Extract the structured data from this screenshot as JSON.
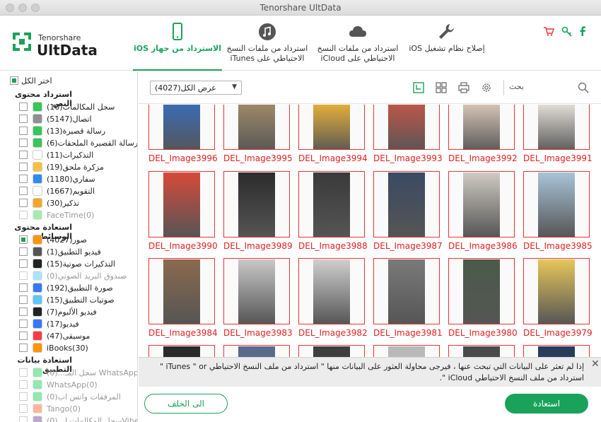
{
  "window": {
    "title": "Tenorshare UltData"
  },
  "logo": {
    "brand": "Tenorshare",
    "name": "UltData"
  },
  "nav": [
    {
      "label": "الاسترداد من جهاز iOS",
      "active": true
    },
    {
      "label": "استرداد من ملفات النسخ الاحتياطي على iTunes",
      "active": false
    },
    {
      "label": "استرداد  من  ملفات النسخ الاحتياطي على iCloud",
      "active": false
    },
    {
      "label": "إصلاح نظام تشغيل iOS",
      "active": false
    }
  ],
  "header_icons": [
    "cart-icon",
    "key-icon",
    "facebook-icon"
  ],
  "sidebar": {
    "select_all": "اختر الكل",
    "groups": [
      {
        "title": "استرداد محتوى النص",
        "items": [
          {
            "label": "سجل المكالمات(10)",
            "checked": false,
            "enabled": true,
            "color": "#35c759"
          },
          {
            "label": "اتصال(5147)",
            "checked": false,
            "enabled": true,
            "color": "#8e8e93"
          },
          {
            "label": "رسالة قصيرة(13)",
            "checked": false,
            "enabled": true,
            "color": "#34c759"
          },
          {
            "label": "رسالة القصيرة الملحقات(6)",
            "checked": false,
            "enabled": true,
            "color": "#34c759"
          },
          {
            "label": "التذكيرات(11)",
            "checked": false,
            "enabled": true,
            "color": "#ffffff"
          },
          {
            "label": "مزكرة ملحق(19)",
            "checked": false,
            "enabled": true,
            "color": "#f7c23a"
          },
          {
            "label": "سفاري(1180)",
            "checked": false,
            "enabled": true,
            "color": "#2d8cf0"
          },
          {
            "label": "التقويم(1667)",
            "checked": false,
            "enabled": true,
            "color": "#ffffff"
          },
          {
            "label": "تذكير(30)",
            "checked": false,
            "enabled": true,
            "color": "#f5a623"
          },
          {
            "label": "(0)FaceTime",
            "checked": false,
            "enabled": false,
            "color": "#4cd964"
          }
        ]
      },
      {
        "title": "استعادة محتوى الوسائط",
        "items": [
          {
            "label": "صور(4027)",
            "checked": true,
            "enabled": true,
            "color": "#ff9500"
          },
          {
            "label": "فيديو التطبيق(1)",
            "checked": false,
            "enabled": true,
            "color": "#555555"
          },
          {
            "label": "التذكيرات صوتية(15)",
            "checked": false,
            "enabled": true,
            "color": "#222222"
          },
          {
            "label": "صندوق البريد الصوتي(0)",
            "checked": false,
            "enabled": false,
            "color": "#5ac8fa"
          },
          {
            "label": "صورة التطبيق(192)",
            "checked": false,
            "enabled": true,
            "color": "#3478f6"
          },
          {
            "label": "صوتيات التطبيق(15)",
            "checked": false,
            "enabled": true,
            "color": "#5ac8fa"
          },
          {
            "label": "فيديو الألبوم(7)",
            "checked": false,
            "enabled": true,
            "color": "#222222"
          },
          {
            "label": "فيديو(17)",
            "checked": false,
            "enabled": true,
            "color": "#3478f6"
          },
          {
            "label": "موسيقى(47)",
            "checked": false,
            "enabled": true,
            "color": "#fc3c44"
          },
          {
            "label": "(30)iBooks",
            "checked": false,
            "enabled": true,
            "color": "#ff9500"
          }
        ]
      },
      {
        "title": "استعادة بيانات التطبيق",
        "items": [
          {
            "label": "WhatsApp سجل المـ...(0)",
            "checked": false,
            "enabled": false,
            "color": "#25d366"
          },
          {
            "label": "(0)WhatsApp",
            "checked": false,
            "enabled": false,
            "color": "#25d366"
          },
          {
            "label": "المرفقات واتس اب(0)",
            "checked": false,
            "enabled": false,
            "color": "#25d366"
          },
          {
            "label": "(0)Tango",
            "checked": false,
            "enabled": false,
            "color": "#ff6f3c"
          },
          {
            "label": "Viberسجل المكالمات ا...(0)",
            "checked": false,
            "enabled": false,
            "color": "#7b519d"
          }
        ]
      }
    ]
  },
  "toolbar": {
    "view_select": "عرض الكل(4027)",
    "search_label": "بحث",
    "icons": [
      "calendar-view-icon",
      "grid-view-icon",
      "print-icon",
      "settings-icon",
      "search-icon"
    ]
  },
  "photos": [
    [
      "DEL_Image3996",
      "DEL_Image3995",
      "DEL_Image3994",
      "DEL_Image3993",
      "DEL_Image3992",
      "DEL_Image3991"
    ],
    [
      "DEL_Image3990",
      "DEL_Image3989",
      "DEL_Image3988",
      "DEL_Image3987",
      "DEL_Image3986",
      "DEL_Image3985"
    ],
    [
      "DEL_Image3984",
      "DEL_Image3983",
      "DEL_Image3982",
      "DEL_Image3981",
      "DEL_Image3980",
      "DEL_Image3979"
    ]
  ],
  "notice": {
    "text": "إذا لم تعثر على البيانات التي تبحث عنها ، فيرجى محاولة العثور على البيانات منها \" استرداد من ملف النسخ الاحتياطي iTunes \" or \" استرداد من ملف النسخ الاحتياطي iCloud \"."
  },
  "buttons": {
    "back": "الى الخلف",
    "restore": "استعادة"
  },
  "colors": {
    "accent": "#1aa25a",
    "thumb_border": "#e33333",
    "caption": "#e21e1e"
  }
}
